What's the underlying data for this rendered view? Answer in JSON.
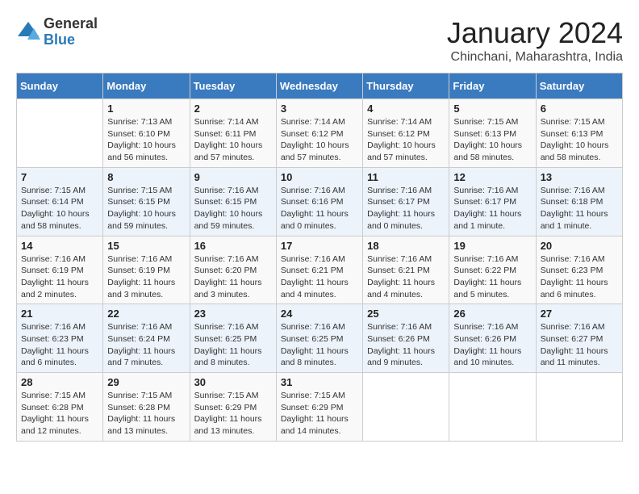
{
  "logo": {
    "general": "General",
    "blue": "Blue"
  },
  "title": "January 2024",
  "subtitle": "Chinchani, Maharashtra, India",
  "days_of_week": [
    "Sunday",
    "Monday",
    "Tuesday",
    "Wednesday",
    "Thursday",
    "Friday",
    "Saturday"
  ],
  "weeks": [
    [
      {
        "day": "",
        "info": ""
      },
      {
        "day": "1",
        "info": "Sunrise: 7:13 AM\nSunset: 6:10 PM\nDaylight: 10 hours and 56 minutes."
      },
      {
        "day": "2",
        "info": "Sunrise: 7:14 AM\nSunset: 6:11 PM\nDaylight: 10 hours and 57 minutes."
      },
      {
        "day": "3",
        "info": "Sunrise: 7:14 AM\nSunset: 6:12 PM\nDaylight: 10 hours and 57 minutes."
      },
      {
        "day": "4",
        "info": "Sunrise: 7:14 AM\nSunset: 6:12 PM\nDaylight: 10 hours and 57 minutes."
      },
      {
        "day": "5",
        "info": "Sunrise: 7:15 AM\nSunset: 6:13 PM\nDaylight: 10 hours and 58 minutes."
      },
      {
        "day": "6",
        "info": "Sunrise: 7:15 AM\nSunset: 6:13 PM\nDaylight: 10 hours and 58 minutes."
      }
    ],
    [
      {
        "day": "7",
        "info": "Sunrise: 7:15 AM\nSunset: 6:14 PM\nDaylight: 10 hours and 58 minutes."
      },
      {
        "day": "8",
        "info": "Sunrise: 7:15 AM\nSunset: 6:15 PM\nDaylight: 10 hours and 59 minutes."
      },
      {
        "day": "9",
        "info": "Sunrise: 7:16 AM\nSunset: 6:15 PM\nDaylight: 10 hours and 59 minutes."
      },
      {
        "day": "10",
        "info": "Sunrise: 7:16 AM\nSunset: 6:16 PM\nDaylight: 11 hours and 0 minutes."
      },
      {
        "day": "11",
        "info": "Sunrise: 7:16 AM\nSunset: 6:17 PM\nDaylight: 11 hours and 0 minutes."
      },
      {
        "day": "12",
        "info": "Sunrise: 7:16 AM\nSunset: 6:17 PM\nDaylight: 11 hours and 1 minute."
      },
      {
        "day": "13",
        "info": "Sunrise: 7:16 AM\nSunset: 6:18 PM\nDaylight: 11 hours and 1 minute."
      }
    ],
    [
      {
        "day": "14",
        "info": "Sunrise: 7:16 AM\nSunset: 6:19 PM\nDaylight: 11 hours and 2 minutes."
      },
      {
        "day": "15",
        "info": "Sunrise: 7:16 AM\nSunset: 6:19 PM\nDaylight: 11 hours and 3 minutes."
      },
      {
        "day": "16",
        "info": "Sunrise: 7:16 AM\nSunset: 6:20 PM\nDaylight: 11 hours and 3 minutes."
      },
      {
        "day": "17",
        "info": "Sunrise: 7:16 AM\nSunset: 6:21 PM\nDaylight: 11 hours and 4 minutes."
      },
      {
        "day": "18",
        "info": "Sunrise: 7:16 AM\nSunset: 6:21 PM\nDaylight: 11 hours and 4 minutes."
      },
      {
        "day": "19",
        "info": "Sunrise: 7:16 AM\nSunset: 6:22 PM\nDaylight: 11 hours and 5 minutes."
      },
      {
        "day": "20",
        "info": "Sunrise: 7:16 AM\nSunset: 6:23 PM\nDaylight: 11 hours and 6 minutes."
      }
    ],
    [
      {
        "day": "21",
        "info": "Sunrise: 7:16 AM\nSunset: 6:23 PM\nDaylight: 11 hours and 6 minutes."
      },
      {
        "day": "22",
        "info": "Sunrise: 7:16 AM\nSunset: 6:24 PM\nDaylight: 11 hours and 7 minutes."
      },
      {
        "day": "23",
        "info": "Sunrise: 7:16 AM\nSunset: 6:25 PM\nDaylight: 11 hours and 8 minutes."
      },
      {
        "day": "24",
        "info": "Sunrise: 7:16 AM\nSunset: 6:25 PM\nDaylight: 11 hours and 8 minutes."
      },
      {
        "day": "25",
        "info": "Sunrise: 7:16 AM\nSunset: 6:26 PM\nDaylight: 11 hours and 9 minutes."
      },
      {
        "day": "26",
        "info": "Sunrise: 7:16 AM\nSunset: 6:26 PM\nDaylight: 11 hours and 10 minutes."
      },
      {
        "day": "27",
        "info": "Sunrise: 7:16 AM\nSunset: 6:27 PM\nDaylight: 11 hours and 11 minutes."
      }
    ],
    [
      {
        "day": "28",
        "info": "Sunrise: 7:15 AM\nSunset: 6:28 PM\nDaylight: 11 hours and 12 minutes."
      },
      {
        "day": "29",
        "info": "Sunrise: 7:15 AM\nSunset: 6:28 PM\nDaylight: 11 hours and 13 minutes."
      },
      {
        "day": "30",
        "info": "Sunrise: 7:15 AM\nSunset: 6:29 PM\nDaylight: 11 hours and 13 minutes."
      },
      {
        "day": "31",
        "info": "Sunrise: 7:15 AM\nSunset: 6:29 PM\nDaylight: 11 hours and 14 minutes."
      },
      {
        "day": "",
        "info": ""
      },
      {
        "day": "",
        "info": ""
      },
      {
        "day": "",
        "info": ""
      }
    ]
  ]
}
